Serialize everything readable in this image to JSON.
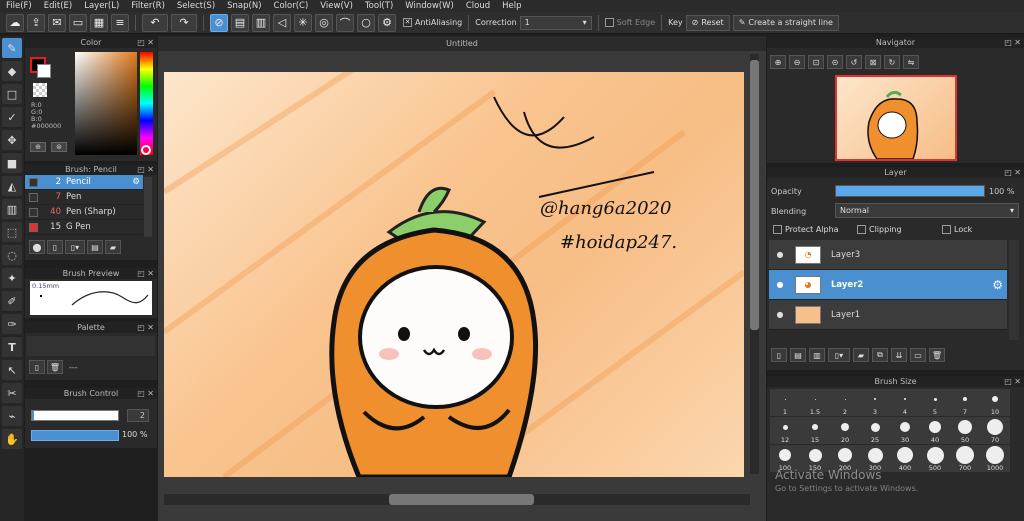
{
  "menu": [
    "File(F)",
    "Edit(E)",
    "Layer(L)",
    "Filter(R)",
    "Select(S)",
    "Snap(N)",
    "Color(C)",
    "View(V)",
    "Tool(T)",
    "Window(W)",
    "Cloud",
    "Help"
  ],
  "toolbar": {
    "antialiasing_label": "AntiAliasing",
    "correction_label": "Correction",
    "correction_value": "1",
    "soft_edge_label": "Soft Edge",
    "key_label": "Key",
    "reset_label": "Reset",
    "straight_line_label": "Create a straight line"
  },
  "color_panel": {
    "title": "Color",
    "r": "R:0",
    "g": "G:0",
    "b": "B:0",
    "hex": "#000000"
  },
  "brush_panel": {
    "title": "Brush: Pencil",
    "items": [
      {
        "size": "2",
        "name": "Pencil",
        "color": "#333333"
      },
      {
        "size": "7",
        "name": "Pen",
        "color": "#333333"
      },
      {
        "size": "40",
        "name": "Pen (Sharp)",
        "color": "#333333"
      },
      {
        "size": "15",
        "name": "G Pen",
        "color": "#e53030"
      }
    ]
  },
  "brush_preview": {
    "title": "Brush Preview",
    "size_label": "0.15mm"
  },
  "palette": {
    "title": "Palette",
    "count_label": "---"
  },
  "brush_control": {
    "title": "Brush Control",
    "size_value": "2",
    "opacity_value": "100 %"
  },
  "canvas": {
    "tab_title": "Untitled"
  },
  "artwork": {
    "signature_line1": "@hang6a2020",
    "signature_line2": "#hoidap247."
  },
  "navigator": {
    "title": "Navigator"
  },
  "layer_panel": {
    "title": "Layer",
    "opacity_label": "Opacity",
    "opacity_value": "100 %",
    "opacity_fraction": 1.0,
    "blending_label": "Blending",
    "blending_value": "Normal",
    "protect_alpha_label": "Protect Alpha",
    "clipping_label": "Clipping",
    "lock_label": "Lock",
    "layers": [
      {
        "name": "Layer3",
        "selected": false
      },
      {
        "name": "Layer2",
        "selected": true
      },
      {
        "name": "Layer1",
        "selected": false
      }
    ]
  },
  "brush_size": {
    "title": "Brush Size",
    "sizes": [
      "1",
      "1.5",
      "2",
      "3",
      "4",
      "5",
      "7",
      "10",
      "12",
      "15",
      "20",
      "25",
      "30",
      "40",
      "50",
      "70",
      "100",
      "150",
      "200",
      "300",
      "400",
      "500",
      "700",
      "1000"
    ]
  },
  "watermark": {
    "line1": "Activate Windows",
    "line2": "Go to Settings to activate Windows."
  },
  "colors": {
    "accent": "#4a8fd0",
    "panel": "#2a2a2a",
    "carrot": "#ef8f2d",
    "leaf": "#8ccf6a"
  }
}
